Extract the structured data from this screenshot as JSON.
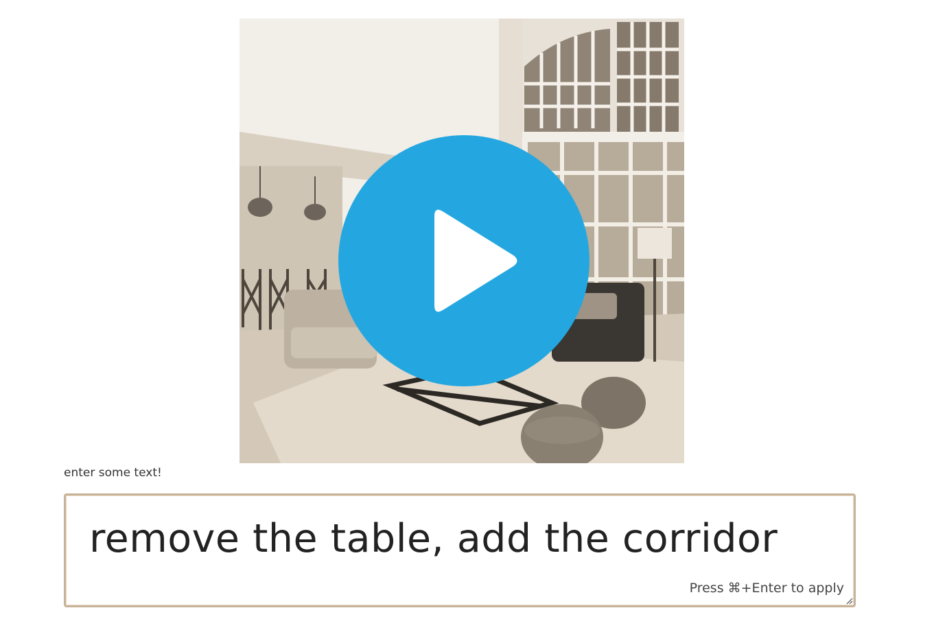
{
  "media": {
    "image_description_name": "living-room-photo",
    "play_icon": "play-icon",
    "play_color": "#24a7e0"
  },
  "prompt": {
    "label": "enter some text!",
    "value": "remove the table, add the corridor",
    "hint": "Press ⌘+Enter to apply",
    "border_color": "#c9b398"
  }
}
